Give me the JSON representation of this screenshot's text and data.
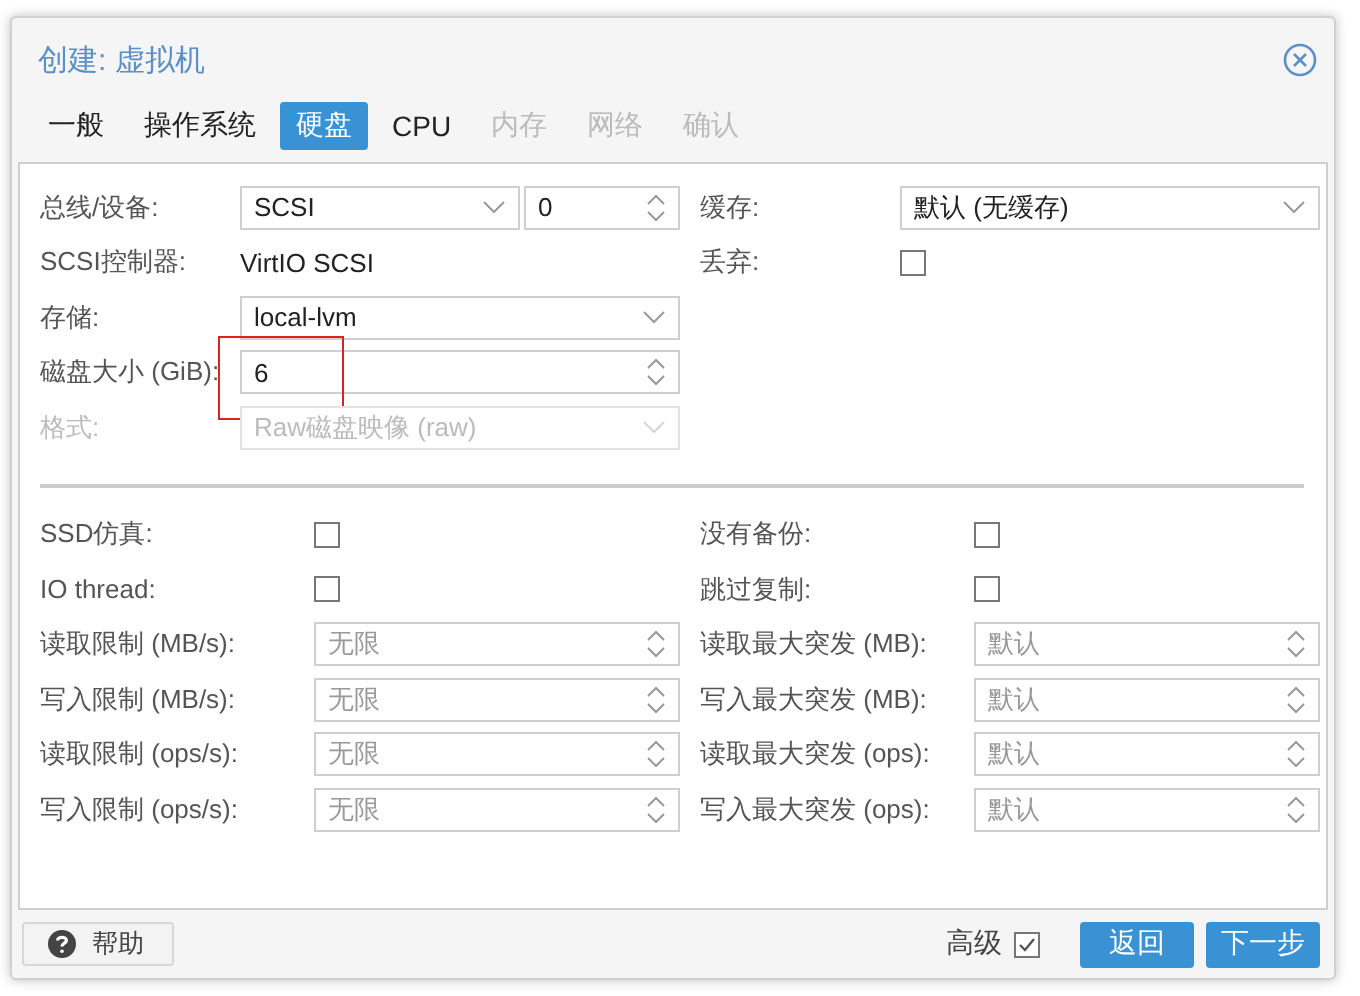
{
  "window": {
    "title": "创建: 虚拟机"
  },
  "tabs": [
    {
      "label": "一般",
      "selected": false,
      "disabled": false
    },
    {
      "label": "操作系统",
      "selected": false,
      "disabled": false
    },
    {
      "label": "硬盘",
      "selected": true,
      "disabled": false
    },
    {
      "label": "CPU",
      "selected": false,
      "disabled": false
    },
    {
      "label": "内存",
      "selected": false,
      "disabled": true
    },
    {
      "label": "网络",
      "selected": false,
      "disabled": true
    },
    {
      "label": "确认",
      "selected": false,
      "disabled": true
    }
  ],
  "top_left": [
    {
      "label": "总线/设备:",
      "kind": "pair",
      "value": "SCSI",
      "device": "0",
      "disabled": false,
      "highlighted": false
    },
    {
      "label": "SCSI控制器:",
      "kind": "static",
      "value": "VirtIO SCSI",
      "disabled": false,
      "highlighted": false
    },
    {
      "label": "存储:",
      "kind": "select",
      "value": "local-lvm",
      "disabled": false,
      "highlighted": false
    },
    {
      "label": "磁盘大小 (GiB):",
      "kind": "number",
      "value": "6",
      "disabled": false,
      "highlighted": true
    },
    {
      "label": "格式:",
      "kind": "select",
      "value": "Raw磁盘映像 (raw)",
      "disabled": true,
      "highlighted": false
    }
  ],
  "top_right": [
    {
      "label": "缓存:",
      "kind": "select",
      "value": "默认 (无缓存)",
      "disabled": false
    },
    {
      "label": "丢弃:",
      "kind": "checkbox",
      "checked": false,
      "disabled": false
    }
  ],
  "bottom_left": [
    {
      "label": "SSD仿真:",
      "kind": "checkbox",
      "checked": false,
      "disabled": false
    },
    {
      "label": "IO thread:",
      "kind": "checkbox",
      "checked": false,
      "disabled": false
    },
    {
      "label": "读取限制 (MB/s):",
      "kind": "number",
      "placeholder": "无限",
      "disabled": false
    },
    {
      "label": "写入限制 (MB/s):",
      "kind": "number",
      "placeholder": "无限",
      "disabled": false
    },
    {
      "label": "读取限制 (ops/s):",
      "kind": "number",
      "placeholder": "无限",
      "disabled": false
    },
    {
      "label": "写入限制 (ops/s):",
      "kind": "number",
      "placeholder": "无限",
      "disabled": false
    }
  ],
  "bottom_right": [
    {
      "label": "没有备份:",
      "kind": "checkbox",
      "checked": false,
      "disabled": false
    },
    {
      "label": "跳过复制:",
      "kind": "checkbox",
      "checked": false,
      "disabled": false
    },
    {
      "label": "读取最大突发 (MB):",
      "kind": "number",
      "placeholder": "默认",
      "disabled": false
    },
    {
      "label": "写入最大突发 (MB):",
      "kind": "number",
      "placeholder": "默认",
      "disabled": false
    },
    {
      "label": "读取最大突发 (ops):",
      "kind": "number",
      "placeholder": "默认",
      "disabled": false
    },
    {
      "label": "写入最大突发 (ops):",
      "kind": "number",
      "placeholder": "默认",
      "disabled": false
    }
  ],
  "footer": {
    "help": "帮助",
    "advanced": {
      "label": "高级",
      "checked": true
    },
    "buttons": [
      "返回",
      "下一步"
    ]
  }
}
